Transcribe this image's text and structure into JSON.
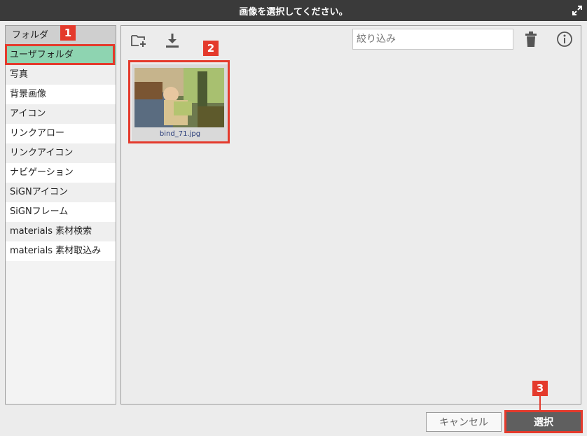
{
  "dialog": {
    "title": "画像を選択してください。"
  },
  "sidebar": {
    "header": "フォルダ",
    "items": [
      {
        "label": "ユーザフォルダ"
      },
      {
        "label": "写真"
      },
      {
        "label": "背景画像"
      },
      {
        "label": "アイコン"
      },
      {
        "label": "リンクアロー"
      },
      {
        "label": "リンクアイコン"
      },
      {
        "label": "ナビゲーション"
      },
      {
        "label": "SiGNアイコン"
      },
      {
        "label": "SiGNフレーム"
      },
      {
        "label": "materials 素材検索"
      },
      {
        "label": "materials 素材取込み"
      }
    ],
    "selected_index": 0
  },
  "toolbar": {
    "filter_placeholder": "絞り込み"
  },
  "files": [
    {
      "name": "bind_71.jpg"
    }
  ],
  "buttons": {
    "cancel": "キャンセル",
    "select": "選択"
  },
  "annotations": {
    "badge_1": "1",
    "badge_2": "2",
    "badge_3": "3"
  },
  "colors": {
    "highlight": "#e43a2c",
    "selected_item": "#8ed4b1",
    "titlebar": "#3a3a3a",
    "select_button": "#5f5f5f"
  }
}
